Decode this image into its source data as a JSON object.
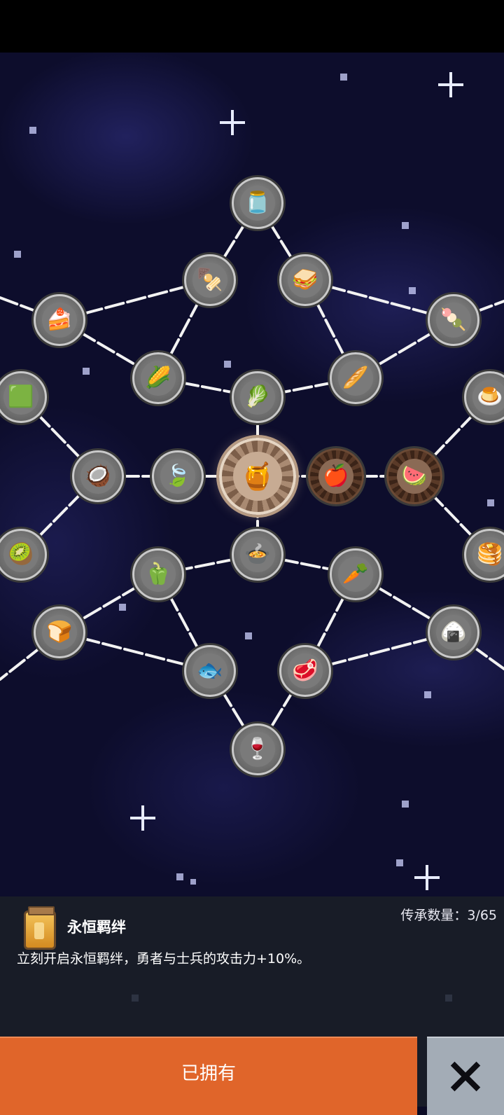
{
  "detail": {
    "count_label": "传承数量：3/65",
    "title": "永恒羁绊",
    "description": "立刻开启永恒羁绊，勇者与士兵的攻击力+10%。",
    "icon": "honey-jar-icon"
  },
  "buttons": {
    "owned_label": "已拥有",
    "close_icon": "close-icon"
  },
  "tree": {
    "nodes": [
      {
        "id": "center-honey-jar",
        "icon": "🍯",
        "state": "selected"
      },
      {
        "id": "apple",
        "icon": "🍎",
        "state": "owned"
      },
      {
        "id": "watermelon",
        "icon": "🍉",
        "state": "owned"
      },
      {
        "id": "poison-jar",
        "icon": "🫙",
        "state": "locked"
      },
      {
        "id": "skewer",
        "icon": "🍢",
        "state": "locked"
      },
      {
        "id": "sandwich",
        "icon": "🥪",
        "state": "locked"
      },
      {
        "id": "chocolate-cake",
        "icon": "🍰",
        "state": "locked"
      },
      {
        "id": "meat-skewer",
        "icon": "🍡",
        "state": "locked"
      },
      {
        "id": "corn",
        "icon": "🌽",
        "state": "locked"
      },
      {
        "id": "baguette",
        "icon": "🥖",
        "state": "locked"
      },
      {
        "id": "cabbage",
        "icon": "🥬",
        "state": "locked"
      },
      {
        "id": "jelly",
        "icon": "🟩",
        "state": "locked"
      },
      {
        "id": "pudding",
        "icon": "🍮",
        "state": "locked"
      },
      {
        "id": "coconut",
        "icon": "🥥",
        "state": "locked"
      },
      {
        "id": "leaf",
        "icon": "🍃",
        "state": "locked"
      },
      {
        "id": "kiwi",
        "icon": "🥝",
        "state": "locked"
      },
      {
        "id": "pancakes",
        "icon": "🥞",
        "state": "locked"
      },
      {
        "id": "soup-bowl",
        "icon": "🍲",
        "state": "locked"
      },
      {
        "id": "pepper",
        "icon": "🫑",
        "state": "locked"
      },
      {
        "id": "radish",
        "icon": "🥕",
        "state": "locked"
      },
      {
        "id": "bread-loaf",
        "icon": "🍞",
        "state": "locked"
      },
      {
        "id": "rice-ball",
        "icon": "🍙",
        "state": "locked"
      },
      {
        "id": "fish",
        "icon": "🐟",
        "state": "locked"
      },
      {
        "id": "steak",
        "icon": "🥩",
        "state": "locked"
      },
      {
        "id": "wine-bottle",
        "icon": "🍷",
        "state": "locked"
      }
    ]
  }
}
